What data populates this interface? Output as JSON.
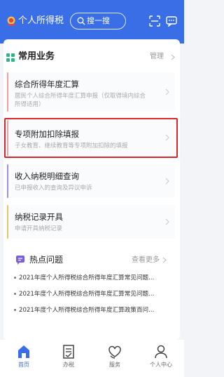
{
  "colors": {
    "brand": "#3a6ee6",
    "highlight_border": "#d8262b",
    "section_icon": "#2fb48a",
    "hot_icon": "#7b5fe0"
  },
  "header": {
    "title": "个人所得税",
    "search_placeholder": "搜一搜",
    "icons": [
      "emblem-icon",
      "search-icon",
      "scan-icon",
      "message-icon"
    ]
  },
  "section": {
    "title": "常用业务",
    "manage_label": "管理"
  },
  "items": [
    {
      "title": "综合所得年度汇算",
      "desc_line1": "居民个人综合所得年度汇算申报（仅取得境内综合",
      "desc_line2": "所得适用）",
      "accent": "#e9a3a3"
    },
    {
      "title": "专项附加扣除填报",
      "desc_line1": "子女教育、继续教育等专项附加扣除的填报",
      "accent": "#e9a3a3"
    },
    {
      "title": "收入纳税明细查询",
      "desc_line1": "已申报收入的查询及异议申诉",
      "accent": "#9f8de8"
    },
    {
      "title": "纳税记录开具",
      "desc_line1": "申请开具纳税记录",
      "accent": "#e8c66f"
    }
  ],
  "hot": {
    "title": "热点问题",
    "more_label": "查看更多",
    "questions": [
      "2021年度个人所得税综合所得年度汇算常见问题...",
      "2021年度个人所得税综合所得年度汇算常见问题...",
      "2021年度个人所得税综合所得年度汇算政策百问..."
    ]
  },
  "tabs": [
    {
      "label": "首页",
      "icon": "home-icon",
      "active": true
    },
    {
      "label": "办税",
      "icon": "tax-form-icon",
      "active": false
    },
    {
      "label": "服务",
      "icon": "service-heart-icon",
      "active": false
    },
    {
      "label": "个人中心",
      "icon": "profile-icon",
      "active": false
    }
  ]
}
